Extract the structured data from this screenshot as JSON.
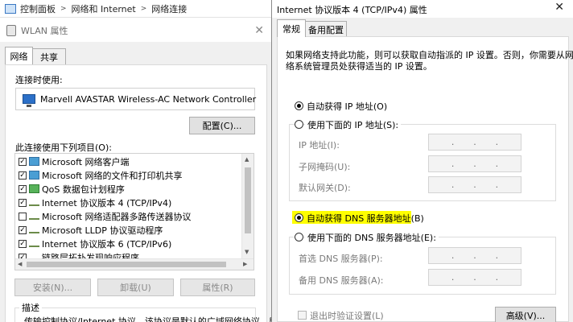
{
  "explorer": {
    "breadcrumbs": [
      "控制面板",
      "网络和 Internet",
      "网络连接"
    ],
    "separator": ">"
  },
  "wlan_window": {
    "title": "WLAN 属性",
    "close_glyph": "✕",
    "tabs": [
      {
        "label": "网络",
        "active": true
      },
      {
        "label": "共享",
        "active": false
      }
    ],
    "connect_using_label": "连接时使用:",
    "adapter_name": "Marvell AVASTAR Wireless-AC Network Controller",
    "configure_button": "配置(C)...",
    "items_label": "此连接使用下列项目(O):",
    "items": [
      {
        "label": "Microsoft 网络客户端",
        "checked": true,
        "icon": "network-client-icon"
      },
      {
        "label": "Microsoft 网络的文件和打印机共享",
        "checked": true,
        "icon": "file-printer-sharing-icon"
      },
      {
        "label": "QoS 数据包计划程序",
        "checked": true,
        "icon": "qos-scheduler-icon"
      },
      {
        "label": "Internet 协议版本 4 (TCP/IPv4)",
        "checked": true,
        "icon": "protocol-icon"
      },
      {
        "label": "Microsoft 网络适配器多路传送器协议",
        "checked": false,
        "icon": "protocol-icon"
      },
      {
        "label": "Microsoft LLDP 协议驱动程序",
        "checked": true,
        "icon": "protocol-icon"
      },
      {
        "label": "Internet 协议版本 6 (TCP/IPv6)",
        "checked": true,
        "icon": "protocol-icon"
      },
      {
        "label": "链路层拓扑发现响应程序",
        "checked": true,
        "icon": "protocol-icon"
      }
    ],
    "install_button": "安装(N)...",
    "uninstall_button": "卸载(U)",
    "properties_button": "属性(R)",
    "description_label": "描述",
    "description_text": "传输控制协议/Internet 协议。该协议是默认的广域网络协议，用"
  },
  "ipv4_window": {
    "title": "Internet 协议版本 4 (TCP/IPv4) 属性",
    "close_glyph": "✕",
    "tabs": [
      {
        "label": "常规",
        "active": true
      },
      {
        "label": "备用配置",
        "active": false
      }
    ],
    "intro_line1": "如果网络支持此功能，则可以获取自动指派的 IP 设置。否则，你需要从网",
    "intro_line2": "络系统管理员处获得适当的 IP 设置。",
    "auto_ip_label": "自动获得 IP 地址(O)",
    "manual_ip_label": "使用下面的 IP 地址(S):",
    "ip_address_label": "IP 地址(I):",
    "subnet_label": "子网掩码(U):",
    "gateway_label": "默认网关(D):",
    "ip_dots": ".",
    "auto_dns_label": "自动获得 DNS 服务器地址(B)",
    "manual_dns_label": "使用下面的 DNS 服务器地址(E):",
    "preferred_dns_label": "首选 DNS 服务器(P):",
    "alternate_dns_label": "备用 DNS 服务器(A):",
    "validate_label": "退出时验证设置(L)",
    "advanced_button": "高级(V)...",
    "selected": {
      "ip": "auto",
      "dns": "auto"
    },
    "highlight_color": "#ffff00"
  }
}
